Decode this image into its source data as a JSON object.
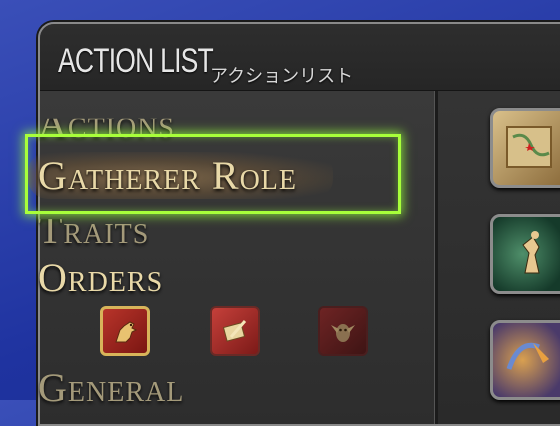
{
  "window": {
    "title": "ACTION LIST",
    "subtitle": "アクションリスト"
  },
  "categories": [
    {
      "label": "Actions",
      "state": "partially-visible"
    },
    {
      "label": "Gatherer Role",
      "state": "selected"
    },
    {
      "label": "Traits",
      "state": "partially-visible"
    },
    {
      "label": "Orders",
      "state": "normal"
    },
    {
      "label": "General",
      "state": "partially-visible"
    }
  ],
  "order_icons": [
    "chocobo-icon",
    "scroll-quill-icon",
    "owl-icon"
  ],
  "action_icons": [
    "treasure-map-icon",
    "gatherer-silhouette-icon",
    "gathering-tool-icon"
  ],
  "colors": {
    "background": "#2a3fb0",
    "label": "#e9d9a8",
    "highlight": "#a8ff3a",
    "window": "#333333"
  }
}
